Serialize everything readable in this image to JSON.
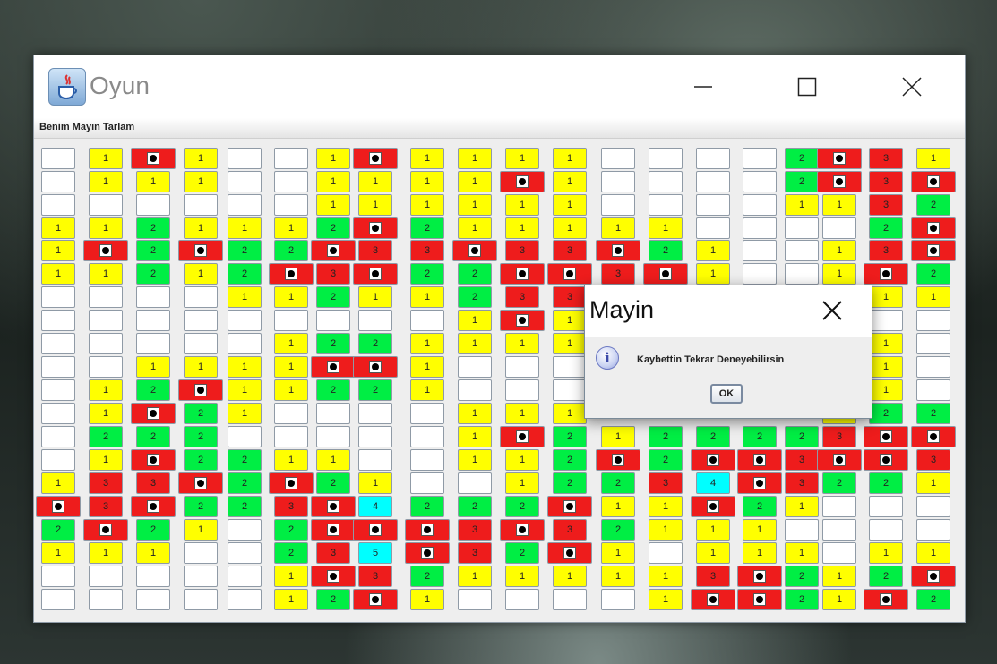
{
  "window": {
    "title": "Oyun",
    "menu_title": "Benim Mayın Tarlam",
    "controls": [
      "minimize-icon",
      "maximize-icon",
      "close-icon"
    ]
  },
  "dialog": {
    "title": "Mayin",
    "message": "Kaybettin Tekrar Deneyebilirsin",
    "ok_label": "OK",
    "icon": "info-icon"
  },
  "colors": {
    "empty": "#ffffff",
    "one": "#ffff00",
    "two": "#00ee44",
    "three": "#ee1c1c",
    "four_five": "#00ffff",
    "mine": "#ee1c1c"
  },
  "legend_codes": {
    "e": "empty cell",
    "M": "mine cell",
    "y": "yellow cell without number",
    "g": "green cell without number",
    "r": "red cell without number"
  },
  "board": {
    "rows": 20,
    "cols": 20,
    "cells": [
      [
        "e",
        "1",
        "M",
        "1",
        "e",
        "e",
        "1",
        "M",
        "1",
        "1",
        "1",
        "1",
        "e",
        "e",
        "e",
        "e",
        "2",
        "M",
        "3",
        "1"
      ],
      [
        "e",
        "1",
        "1",
        "1",
        "e",
        "e",
        "1",
        "1",
        "1",
        "1",
        "M",
        "1",
        "e",
        "e",
        "e",
        "e",
        "2",
        "M",
        "3",
        "M"
      ],
      [
        "e",
        "e",
        "e",
        "e",
        "e",
        "e",
        "1",
        "1",
        "1",
        "1",
        "1",
        "1",
        "e",
        "e",
        "e",
        "e",
        "1",
        "1",
        "3",
        "2"
      ],
      [
        "1",
        "1",
        "2",
        "1",
        "1",
        "1",
        "2",
        "M",
        "2",
        "1",
        "1",
        "1",
        "1",
        "1",
        "e",
        "e",
        "e",
        "e",
        "2",
        "M"
      ],
      [
        "1",
        "M",
        "2",
        "M",
        "2",
        "2",
        "M",
        "3",
        "3",
        "M",
        "3",
        "3",
        "M",
        "2",
        "1",
        "e",
        "e",
        "1",
        "3",
        "M"
      ],
      [
        "1",
        "1",
        "2",
        "1",
        "2",
        "M",
        "3",
        "M",
        "2",
        "2",
        "M",
        "M",
        "3",
        "M",
        "1",
        "e",
        "e",
        "1",
        "M",
        "2"
      ],
      [
        "e",
        "e",
        "e",
        "e",
        "1",
        "1",
        "2",
        "1",
        "1",
        "2",
        "3",
        "3",
        "",
        "",
        "",
        "",
        "",
        "1",
        "1",
        "1"
      ],
      [
        "e",
        "e",
        "e",
        "e",
        "e",
        "e",
        "e",
        "e",
        "e",
        "1",
        "M",
        "1",
        "",
        "",
        "",
        "",
        "",
        "e",
        "e",
        "e"
      ],
      [
        "e",
        "e",
        "e",
        "e",
        "e",
        "1",
        "2",
        "2",
        "1",
        "1",
        "1",
        "1",
        "",
        "",
        "",
        "",
        "",
        "1",
        "1",
        "e"
      ],
      [
        "e",
        "e",
        "1",
        "1",
        "1",
        "1",
        "M",
        "M",
        "1",
        "e",
        "e",
        "e",
        "",
        "",
        "",
        "",
        "",
        "1",
        "1",
        "e"
      ],
      [
        "e",
        "1",
        "2",
        "M",
        "1",
        "1",
        "2",
        "2",
        "1",
        "e",
        "e",
        "e",
        "",
        "",
        "",
        "",
        "",
        "1",
        "1",
        "e"
      ],
      [
        "e",
        "1",
        "M",
        "2",
        "1",
        "e",
        "e",
        "e",
        "e",
        "1",
        "1",
        "1",
        "",
        "",
        "",
        "",
        "",
        "y",
        "2",
        "2"
      ],
      [
        "e",
        "2",
        "2",
        "2",
        "e",
        "e",
        "e",
        "e",
        "e",
        "1",
        "M",
        "2",
        "1",
        "2",
        "2",
        "2",
        "2",
        "3",
        "M",
        "M"
      ],
      [
        "e",
        "1",
        "M",
        "2",
        "2",
        "1",
        "1",
        "e",
        "e",
        "1",
        "1",
        "2",
        "M",
        "2",
        "M",
        "M",
        "3",
        "M",
        "M",
        "3"
      ],
      [
        "1",
        "3",
        "3",
        "M",
        "2",
        "M",
        "2",
        "1",
        "e",
        "e",
        "1",
        "2",
        "2",
        "3",
        "4",
        "M",
        "3",
        "2",
        "2",
        "1"
      ],
      [
        "M",
        "3",
        "M",
        "2",
        "2",
        "3",
        "M",
        "4",
        "2",
        "2",
        "2",
        "M",
        "1",
        "1",
        "M",
        "2",
        "1",
        "e",
        "e",
        "e"
      ],
      [
        "2",
        "M",
        "2",
        "1",
        "e",
        "2",
        "M",
        "M",
        "M",
        "3",
        "M",
        "3",
        "2",
        "1",
        "1",
        "1",
        "e",
        "e",
        "e",
        "e"
      ],
      [
        "1",
        "1",
        "1",
        "e",
        "e",
        "2",
        "3",
        "5",
        "M",
        "3",
        "2",
        "M",
        "1",
        "e",
        "1",
        "1",
        "1",
        "e",
        "1",
        "1"
      ],
      [
        "e",
        "e",
        "e",
        "e",
        "e",
        "1",
        "M",
        "3",
        "2",
        "1",
        "1",
        "1",
        "1",
        "1",
        "3",
        "M",
        "2",
        "1",
        "2",
        "M"
      ],
      [
        "e",
        "e",
        "e",
        "e",
        "e",
        "1",
        "2",
        "M",
        "1",
        "e",
        "e",
        "e",
        "e",
        "1",
        "M",
        "M",
        "2",
        "1",
        "M",
        "2"
      ]
    ]
  }
}
